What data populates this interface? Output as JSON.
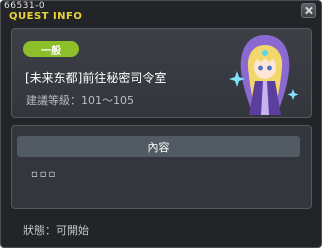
{
  "window": {
    "quest_id": "66531-0",
    "title": "QUEST INFO"
  },
  "quest": {
    "category_badge": "一般",
    "name": "[未来东都]前往秘密司令室",
    "level_requirement": "建議等級：101～105"
  },
  "content": {
    "header": "內容",
    "text": "▫▫▫"
  },
  "status": {
    "text": "狀態：可開始"
  },
  "icons": {
    "close": "close-icon",
    "portrait": "npc-portrait"
  },
  "colors": {
    "title": "#e9d23a",
    "badge": "#8dbf2b",
    "panel": "#3c3f45",
    "background": "#222428"
  }
}
